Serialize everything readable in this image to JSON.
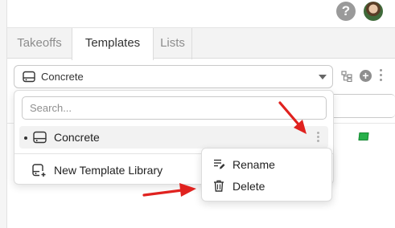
{
  "header": {
    "help_icon": "help-circle-icon",
    "help_glyph": "?",
    "avatar_icon": "user-avatar"
  },
  "tabs": [
    {
      "label": "Takeoffs",
      "active": false
    },
    {
      "label": "Templates",
      "active": true
    },
    {
      "label": "Lists",
      "active": false
    }
  ],
  "library_select": {
    "value": "Concrete",
    "icon": "drive-icon"
  },
  "toolbar": {
    "icons": [
      "tree-structure-icon",
      "add-circle-icon",
      "more-vertical-icon"
    ],
    "add_glyph": "+"
  },
  "dropdown": {
    "search_placeholder": "Search...",
    "items": [
      {
        "label": "Concrete",
        "selected": true,
        "bullet": "•"
      }
    ],
    "new_library_label": "New Template Library"
  },
  "context_menu": {
    "items": [
      {
        "label": "Rename",
        "icon": "edit-note-icon"
      },
      {
        "label": "Delete",
        "icon": "trash-icon"
      }
    ]
  },
  "colors": {
    "arrow": "#e0221f",
    "flag": "#27b04a"
  }
}
